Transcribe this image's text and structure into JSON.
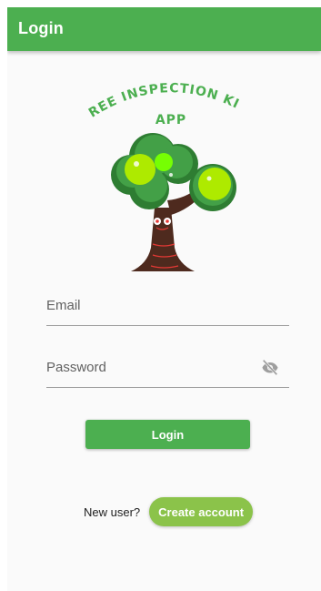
{
  "appbar": {
    "title": "Login"
  },
  "logo": {
    "line1": "TREE INSPECTION KIT",
    "line2": "APP",
    "icon": "tree-mascot-icon"
  },
  "form": {
    "email_placeholder": "Email",
    "email_value": "",
    "password_placeholder": "Password",
    "password_value": "",
    "visibility_icon": "eye-off-icon",
    "login_label": "Login"
  },
  "signup": {
    "prompt": "New user?",
    "button_label": "Create account"
  },
  "colors": {
    "primary": "#4caf50",
    "accent": "#8bc34a",
    "background": "#fafafa",
    "underline": "#9e9e9e"
  }
}
